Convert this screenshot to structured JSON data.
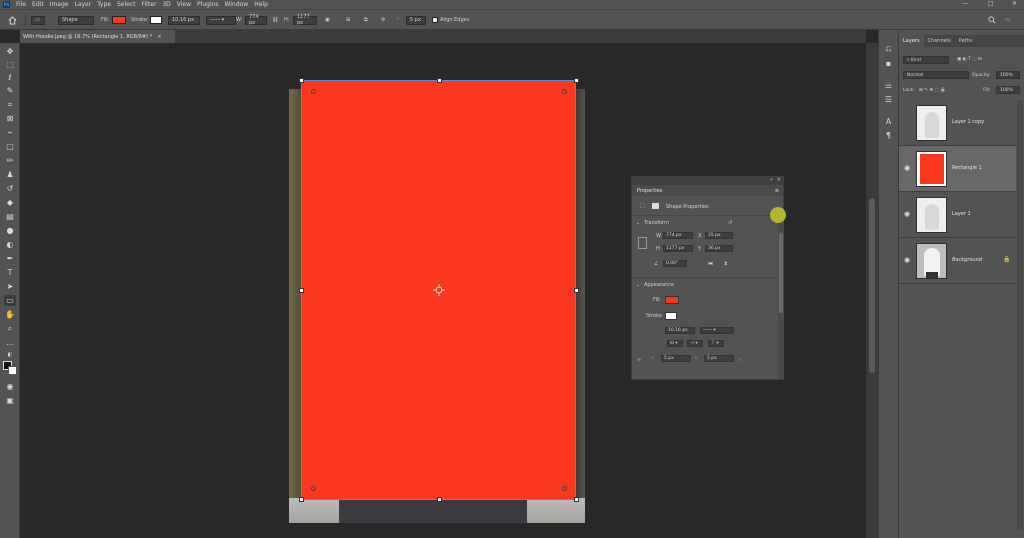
{
  "app": {
    "logo": "Ps",
    "menu": [
      "File",
      "Edit",
      "Image",
      "Layer",
      "Type",
      "Select",
      "Filter",
      "3D",
      "View",
      "Plugins",
      "Window",
      "Help"
    ],
    "window_controls": [
      "—",
      "□",
      "✕"
    ]
  },
  "options": {
    "mode": "Shape",
    "fill_label": "Fill:",
    "fill_color": "#fc371f",
    "stroke_label": "Stroke:",
    "stroke_width": "10.16 px",
    "w_label": "W:",
    "w_value": "774 px",
    "h_label": "H:",
    "h_value": "1177 px",
    "radius": "5 px",
    "align_edges": "Align Edges"
  },
  "document": {
    "tab_title": "With Hoodie.jpeg @ 16.7% (Rectangle 1, RGB/8#) *",
    "tab_close": "×"
  },
  "properties": {
    "title": "Properties",
    "tab": "Shape Properties",
    "transform_heading": "Transform",
    "w_label": "W",
    "w_value": "774 px",
    "x_label": "X",
    "x_value": "35 px",
    "h_label": "H",
    "h_value": "1177 px",
    "y_label": "Y",
    "y_value": "36 px",
    "angle": "0.00°",
    "appearance_heading": "Appearance",
    "fill_label": "Fill",
    "stroke_label": "Stroke",
    "stroke_width": "10.16 px",
    "corner_tl": "5 px",
    "corner_tr": "5 px"
  },
  "layers": {
    "tabs": [
      "Layers",
      "Channels",
      "Paths"
    ],
    "filter_kind": "Kind",
    "blend_mode": "Normal",
    "opacity_label": "Opacity:",
    "opacity_value": "100%",
    "lock_label": "Lock:",
    "fill_label": "Fill:",
    "fill_value": "100%",
    "items": [
      {
        "name": "Layer 1 copy",
        "visible": false
      },
      {
        "name": "Rectangle 1",
        "visible": true,
        "selected": true
      },
      {
        "name": "Layer 1",
        "visible": true
      },
      {
        "name": "Background",
        "visible": true,
        "locked": true
      }
    ]
  },
  "colors": {
    "accent_shape": "#fc371f",
    "selection": "#4b90d8"
  }
}
